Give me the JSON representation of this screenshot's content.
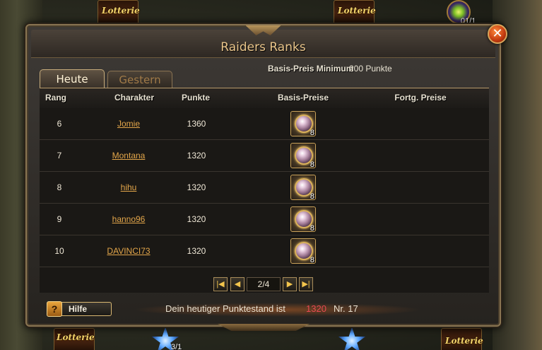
{
  "background": {
    "lottery_labels": [
      "Lotterie",
      "Lotterie",
      "Lotterie",
      "Lotterie"
    ],
    "counters": [
      "01/1",
      "3/1"
    ]
  },
  "window": {
    "title": "Raiders Ranks",
    "close_label": "✕"
  },
  "tabs": [
    {
      "label": "Heute",
      "active": true
    },
    {
      "label": "Gestern",
      "active": false
    }
  ],
  "minimum": {
    "label": "Basis-Preis Minimum",
    "value": "200 Punkte"
  },
  "table": {
    "columns": [
      "Rang",
      "Charakter",
      "Punkte",
      "Basis-Preise",
      "Fortg. Preise"
    ],
    "rows": [
      {
        "rank": "6",
        "character": "Jomie",
        "points": "1360",
        "prize_qty": "8"
      },
      {
        "rank": "7",
        "character": "Montana",
        "points": "1320",
        "prize_qty": "8"
      },
      {
        "rank": "8",
        "character": "hihu",
        "points": "1320",
        "prize_qty": "8"
      },
      {
        "rank": "9",
        "character": "hanno96",
        "points": "1320",
        "prize_qty": "8"
      },
      {
        "rank": "10",
        "character": "DAVINCI73",
        "points": "1320",
        "prize_qty": "8"
      }
    ]
  },
  "pager": {
    "page": "2/4"
  },
  "footer": {
    "help_icon": "?",
    "help_label": "Hilfe",
    "score_label": "Dein heutiger Punktestand ist",
    "score_value": "1320",
    "rank_label": "Nr. 17"
  },
  "colors": {
    "accent": "#e3a64a",
    "score": "#e84a52",
    "frame": "#8a7552"
  }
}
